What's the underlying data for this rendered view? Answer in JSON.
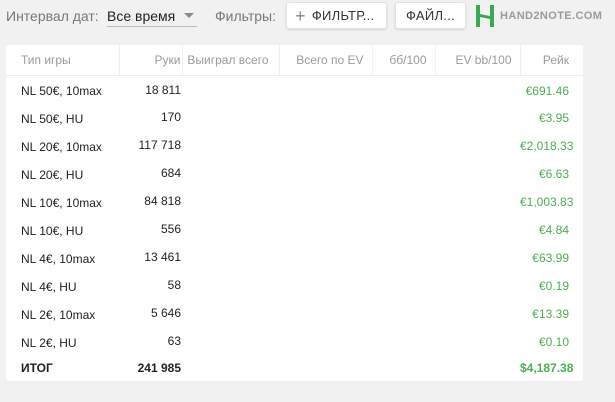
{
  "toolbar": {
    "interval_label": "Интервал дат:",
    "interval_value": "Все время",
    "filters_label": "Фильтры:",
    "filter_button": "ФИЛЬТР...",
    "file_button": "ФАЙЛ...",
    "logo_text": "HAND2NOTE.COM"
  },
  "table": {
    "headers": {
      "game": "Тип игры",
      "hands": "Руки",
      "won": "Выиграл всего",
      "ev": "Всего по EV",
      "bb": "бб/100",
      "evbb": "EV bb/100",
      "rake": "Рейк"
    },
    "rows": [
      {
        "game": "NL 50€, 10max",
        "hands": "18 811",
        "rake": "€691.46"
      },
      {
        "game": "NL 50€, HU",
        "hands": "170",
        "rake": "€3.95"
      },
      {
        "game": "NL 20€, 10max",
        "hands": "117 718",
        "rake": "€2,018.33"
      },
      {
        "game": "NL 20€, HU",
        "hands": "684",
        "rake": "€6.63"
      },
      {
        "game": "NL 10€, 10max",
        "hands": "84 818",
        "rake": "€1,003.83"
      },
      {
        "game": "NL 10€, HU",
        "hands": "556",
        "rake": "€4.84"
      },
      {
        "game": "NL 4€, 10max",
        "hands": "13 461",
        "rake": "€63.99"
      },
      {
        "game": "NL 4€, HU",
        "hands": "58",
        "rake": "€0.19"
      },
      {
        "game": "NL 2€, 10max",
        "hands": "5 646",
        "rake": "€13.39"
      },
      {
        "game": "NL 2€, HU",
        "hands": "63",
        "rake": "€0.10"
      }
    ],
    "total": {
      "game": "ИТОГ",
      "hands": "241 985",
      "rake": "$4,187.38"
    }
  },
  "colors": {
    "rake_green": "#4caf50",
    "logo_green": "#3aa856"
  }
}
